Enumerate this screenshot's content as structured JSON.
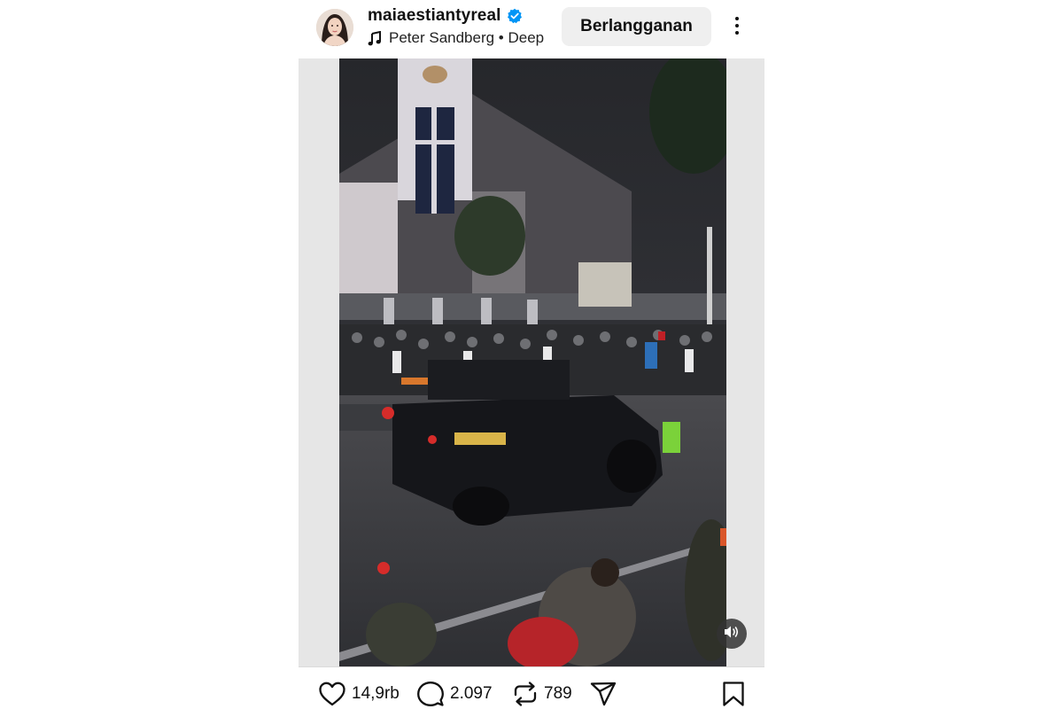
{
  "header": {
    "username": "maiaestiantyreal",
    "verified_icon": "verified-badge-icon",
    "music": "Peter Sandberg • Deep",
    "subscribe_label": "Berlangganan",
    "more_icon": "more-vertical-icon"
  },
  "media": {
    "type": "video",
    "mute_icon": "speaker-icon"
  },
  "actions": {
    "likes": "14,9rb",
    "comments": "2.097",
    "reposts": "789",
    "icons": [
      "heart-icon",
      "comment-icon",
      "repost-icon",
      "share-icon",
      "bookmark-icon"
    ]
  },
  "colors": {
    "verified": "#0095f6",
    "subscribe_bg": "#efefef",
    "letterbox": "#e6e6e6"
  }
}
